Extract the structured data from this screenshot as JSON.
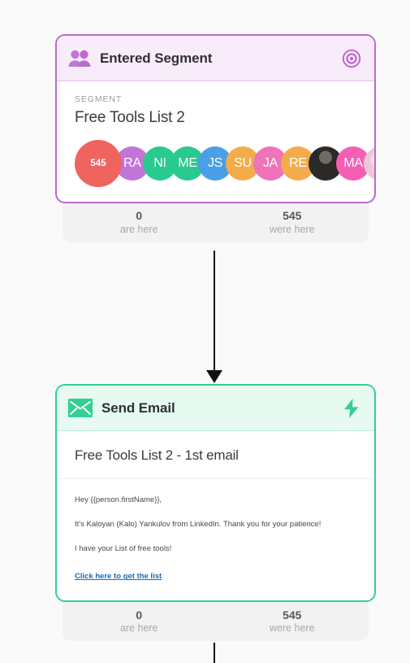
{
  "page": {
    "background": "#fafafa"
  },
  "nodes": [
    {
      "id": "entered-segment",
      "type": "trigger",
      "accent": "#bb6bcd",
      "header": {
        "title": "Entered Segment",
        "icon": "people-icon",
        "action_icon": "target-icon"
      },
      "body": {
        "eyebrow": "SEGMENT",
        "segment_name": "Free Tools List 2",
        "count_bubble": "545",
        "avatars": [
          {
            "initials": "RA",
            "color": "#c275d8"
          },
          {
            "initials": "NI",
            "color": "#29ca8f"
          },
          {
            "initials": "ME",
            "color": "#29ca8f"
          },
          {
            "initials": "JS",
            "color": "#4a9fe8"
          },
          {
            "initials": "SU",
            "color": "#f4ac4a"
          },
          {
            "initials": "JA",
            "color": "#f072b9"
          },
          {
            "initials": "RE",
            "color": "#f4ac4a"
          },
          {
            "initials": "",
            "color": "#2b2a28",
            "kind": "photo-dark"
          },
          {
            "initials": "MA",
            "color": "#f45fb5"
          },
          {
            "initials": "",
            "color": "#edc9d8",
            "kind": "photo-light"
          }
        ]
      },
      "stats": {
        "current_value": "0",
        "current_label": "are here",
        "total_value": "545",
        "total_label": "were here"
      }
    },
    {
      "id": "send-email",
      "type": "action",
      "accent": "#33cf96",
      "header": {
        "title": "Send Email",
        "icon": "envelope-icon",
        "action_icon": "lightning-bolt-icon"
      },
      "body": {
        "subject": "Free Tools List 2 - 1st email",
        "preview_lines": [
          "Hey {{person.firstName}},",
          "It's Kaloyan (Kalo) Yankulov from LinkedIn. Thank you for your patience!",
          "I have your List of free tools!"
        ],
        "link_text": "Click here to get the list"
      },
      "stats": {
        "current_value": "0",
        "current_label": "are here",
        "total_value": "545",
        "total_label": "were here"
      }
    }
  ]
}
